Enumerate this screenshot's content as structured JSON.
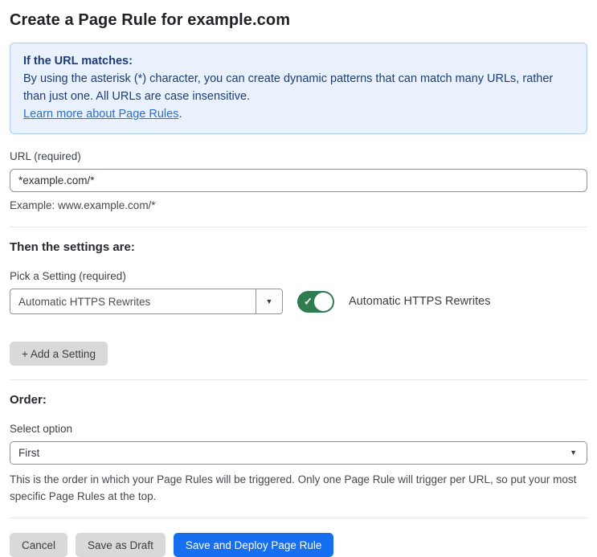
{
  "page": {
    "title": "Create a Page Rule for example.com"
  },
  "info_box": {
    "heading": "If the URL matches:",
    "body": "By using the asterisk (*) character, you can create dynamic patterns that can match many URLs, rather than just one. All URLs are case insensitive.",
    "link_text": "Learn more about Page Rules",
    "link_suffix": "."
  },
  "url_field": {
    "label": "URL (required)",
    "value": "*example.com/*",
    "helper": "Example: www.example.com/*"
  },
  "settings_section": {
    "heading": "Then the settings are:",
    "picker_label": "Pick a Setting (required)",
    "picker_value": "Automatic HTTPS Rewrites",
    "toggle_state": "on",
    "toggle_check": "✓",
    "toggle_label": "Automatic HTTPS Rewrites",
    "add_button_label": "+ Add a Setting"
  },
  "order_section": {
    "heading": "Order:",
    "label": "Select option",
    "value": "First",
    "helper": "This is the order in which your Page Rules will be triggered. Only one Page Rule will trigger per URL, so put your most specific Page Rules at the top."
  },
  "footer": {
    "cancel_label": "Cancel",
    "save_draft_label": "Save as Draft",
    "save_deploy_label": "Save and Deploy Page Rule"
  },
  "icons": {
    "dropdown_caret": "▼"
  },
  "colors": {
    "accent_blue": "#156ff0",
    "info_bg": "#e9f2fc",
    "info_border": "#abcdf0",
    "info_text": "#1e3c78",
    "link_blue": "#2b6fce",
    "toggle_green": "#2e7c4f",
    "button_gray": "#d9d9d9"
  }
}
